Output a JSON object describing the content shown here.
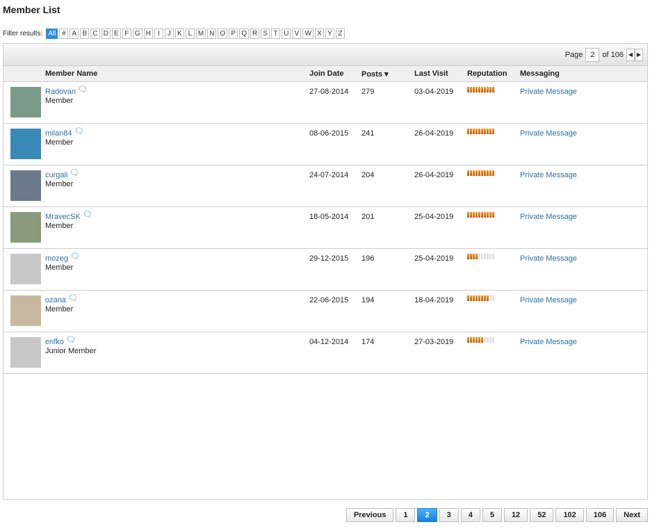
{
  "title": "Member List",
  "filter": {
    "label": "Filter results:",
    "letters": [
      "All",
      "#",
      "A",
      "B",
      "C",
      "D",
      "E",
      "F",
      "G",
      "H",
      "I",
      "J",
      "K",
      "L",
      "M",
      "N",
      "O",
      "P",
      "Q",
      "R",
      "S",
      "T",
      "U",
      "V",
      "W",
      "X",
      "Y",
      "Z"
    ]
  },
  "pagenav": {
    "page_label": "Page",
    "current": "2",
    "of_label": "of 106"
  },
  "headers": {
    "name": "Member Name",
    "join": "Join Date",
    "posts": "Posts ▾",
    "visit": "Last Visit",
    "rep": "Reputation",
    "msg": "Messaging"
  },
  "members": [
    {
      "name": "Radovan",
      "rank": "Member",
      "join": "27-08-2014",
      "posts": "279",
      "visit": "03-04-2019",
      "rep": 10,
      "msg": "Private Message",
      "av": "#7a9a8a"
    },
    {
      "name": "milan84",
      "rank": "Member",
      "join": "08-06-2015",
      "posts": "241",
      "visit": "26-04-2019",
      "rep": 10,
      "msg": "Private Message",
      "av": "#3a8ab8"
    },
    {
      "name": "curgali",
      "rank": "Member",
      "join": "24-07-2014",
      "posts": "204",
      "visit": "26-04-2019",
      "rep": 10,
      "msg": "Private Message",
      "av": "#6a7a8a"
    },
    {
      "name": "MravecSK",
      "rank": "Member",
      "join": "18-05-2014",
      "posts": "201",
      "visit": "25-04-2019",
      "rep": 10,
      "msg": "Private Message",
      "av": "#8a9a7a"
    },
    {
      "name": "mozeg",
      "rank": "Member",
      "join": "29-12-2015",
      "posts": "196",
      "visit": "25-04-2019",
      "rep": 4,
      "msg": "Private Message",
      "av": "#c8c8c8"
    },
    {
      "name": "ozana",
      "rank": "Member",
      "join": "22-06-2015",
      "posts": "194",
      "visit": "18-04-2019",
      "rep": 8,
      "msg": "Private Message",
      "av": "#c8b8a0"
    },
    {
      "name": "enfko",
      "rank": "Junior Member",
      "join": "04-12-2014",
      "posts": "174",
      "visit": "27-03-2019",
      "rep": 6,
      "msg": "Private Message",
      "av": "#c8c8c8"
    }
  ],
  "pager": [
    "Previous",
    "1",
    "2",
    "3",
    "4",
    "5",
    "12",
    "52",
    "102",
    "106",
    "Next"
  ],
  "pager_current": "2"
}
